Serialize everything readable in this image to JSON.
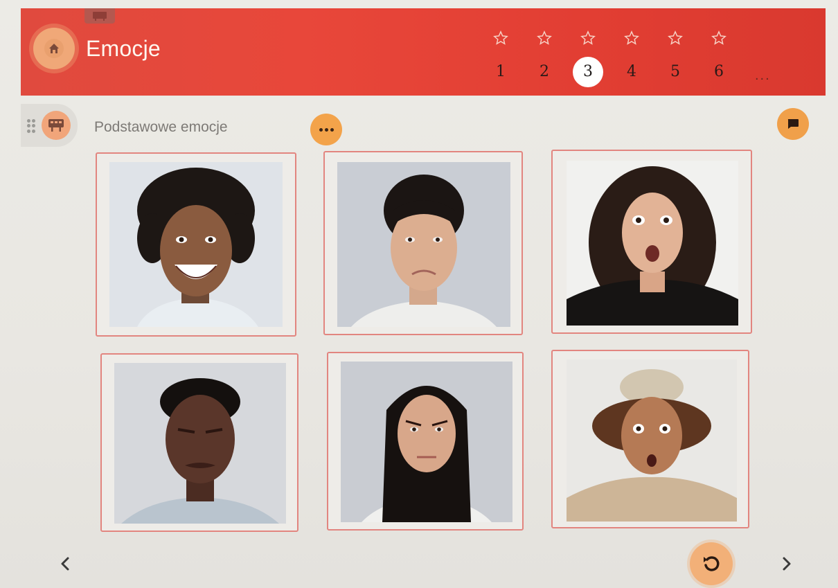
{
  "header": {
    "title": "Emocje",
    "home_icon": "home-icon",
    "accent_color": "#e4463a"
  },
  "pager": {
    "pages": [
      {
        "label": "1",
        "active": false
      },
      {
        "label": "2",
        "active": false
      },
      {
        "label": "3",
        "active": true
      },
      {
        "label": "4",
        "active": false
      },
      {
        "label": "5",
        "active": false
      },
      {
        "label": "6",
        "active": false
      }
    ],
    "more_label": "...",
    "star_icon": "star-outline-icon"
  },
  "section": {
    "title": "Podstawowe emocje",
    "section_icon": "board-icon",
    "more_icon": "more-dots-icon",
    "chat_icon": "chat-bubble-icon",
    "button_color": "#f3a34a"
  },
  "cards": [
    {
      "id": "happy",
      "icon": "face-photo"
    },
    {
      "id": "sad",
      "icon": "face-photo"
    },
    {
      "id": "surprised",
      "icon": "face-photo"
    },
    {
      "id": "disgusted",
      "icon": "face-photo"
    },
    {
      "id": "angry",
      "icon": "face-photo"
    },
    {
      "id": "shocked",
      "icon": "face-photo"
    }
  ],
  "footer": {
    "prev_icon": "chevron-left-icon",
    "next_icon": "chevron-right-icon",
    "reset_icon": "reset-icon"
  }
}
